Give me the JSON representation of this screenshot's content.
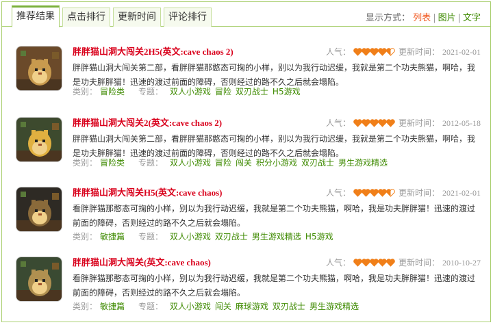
{
  "tabs": [
    "推荐结果",
    "点击排行",
    "更新时间",
    "评论排行"
  ],
  "display": {
    "label": "显示方式：",
    "options": [
      "列表",
      "图片",
      "文字"
    ]
  },
  "labels": {
    "popularity": "人气：",
    "updated": "更新时间：",
    "category": "类别：",
    "topic": "专题："
  },
  "colors": {
    "accent": "#7ab03a",
    "title": "#d9001b",
    "link": "#3e8a00",
    "heart": "#f07f19"
  },
  "items": [
    {
      "title_hl": "胖胖猫山洞大闯关",
      "title_rest": "2H5(英文:cave chaos 2)",
      "rating": 4.5,
      "date": "2021-02-01",
      "desc": "胖胖猫山洞大闯关第二部，看胖胖猫那憨态可掬的小样，别以为我行动迟缓，我就是第二个功夫熊猫，啊哈，我是功夫胖胖猫！迅速的渡过前面的障碍，否则经过的路不久之后就会塌陷。",
      "category": "冒险类",
      "topics": [
        "双人小游戏",
        "冒险",
        "双刃战士",
        "H5游戏"
      ]
    },
    {
      "title_hl": "胖胖猫山洞大闯关",
      "title_rest": "2(英文:cave chaos 2)",
      "rating": 5,
      "date": "2012-05-18",
      "desc": "胖胖猫山洞大闯关第二部，看胖胖猫那憨态可掬的小样，别以为我行动迟缓，我就是第二个功夫熊猫，啊哈，我是功夫胖胖猫！迅速的渡过前面的障碍，否则经过的路不久之后就会塌陷。",
      "category": "冒险类",
      "topics": [
        "双人小游戏",
        "冒险",
        "闯关",
        "积分小游戏",
        "双刃战士",
        "男生游戏精选"
      ]
    },
    {
      "title_hl": "胖胖猫山洞大闯关",
      "title_rest": "H5(英文:cave chaos)",
      "rating": 4.5,
      "date": "2021-02-01",
      "desc": "看胖胖猫那憨态可掬的小样，别以为我行动迟缓，我就是第二个功夫熊猫，啊哈，我是功夫胖胖猫！迅速的渡过前面的障碍，否则经过的路不久之后就会塌陷。",
      "category": "敏捷篇",
      "topics": [
        "双人小游戏",
        "双刃战士",
        "男生游戏精选",
        "H5游戏"
      ]
    },
    {
      "title_hl": "胖胖猫山洞大闯关",
      "title_rest": "(英文:cave chaos)",
      "rating": 5,
      "date": "2010-10-27",
      "desc": "看胖胖猫那憨态可掬的小样，别以为我行动迟缓，我就是第二个功夫熊猫，啊哈，我是功夫胖胖猫！迅速的渡过前面的障碍，否则经过的路不久之后就会塌陷。",
      "category": "敏捷篇",
      "topics": [
        "双人小游戏",
        "闯关",
        "麻球游戏",
        "双刃战士",
        "男生游戏精选"
      ]
    }
  ]
}
